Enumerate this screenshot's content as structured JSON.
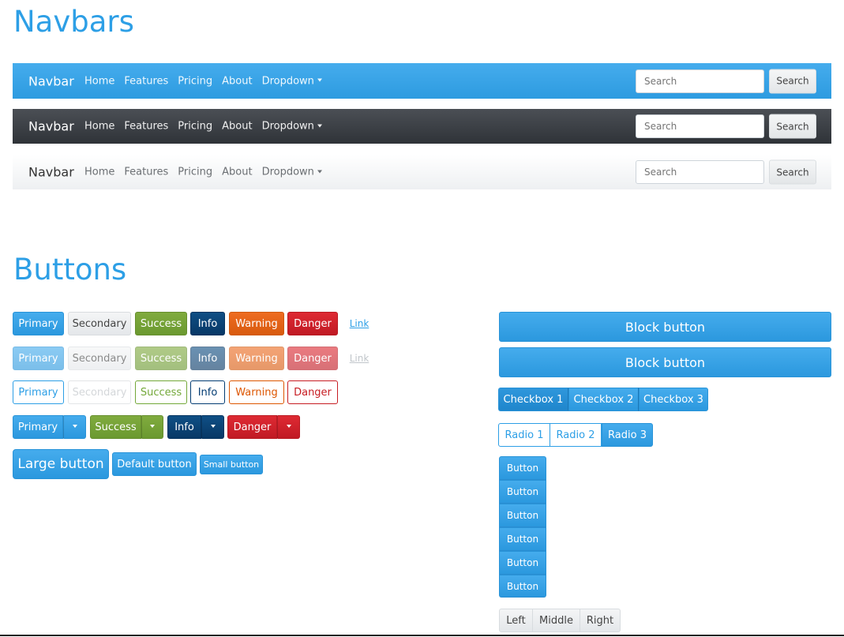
{
  "headings": {
    "navbars": "Navbars",
    "buttons": "Buttons"
  },
  "navbar": {
    "brand": "Navbar",
    "links": [
      "Home",
      "Features",
      "Pricing",
      "About",
      "Dropdown"
    ],
    "search_placeholder": "Search",
    "search_button": "Search"
  },
  "buttons": {
    "row1": [
      "Primary",
      "Secondary",
      "Success",
      "Info",
      "Warning",
      "Danger",
      "Link"
    ],
    "split": [
      "Primary",
      "Success",
      "Info",
      "Danger"
    ],
    "sizes": [
      "Large button",
      "Default button",
      "Small button"
    ],
    "block": [
      "Block button",
      "Block button"
    ],
    "checkboxes": [
      "Checkbox 1",
      "Checkbox 2",
      "Checkbox 3"
    ],
    "radios": [
      "Radio 1",
      "Radio 2",
      "Radio 3"
    ],
    "vertical": [
      "Button",
      "Button",
      "Button",
      "Button",
      "Button",
      "Button"
    ],
    "lmr": [
      "Left",
      "Middle",
      "Right"
    ]
  },
  "colors": {
    "primary": "#2d9fe6",
    "success": "#73a839",
    "info": "#033c73",
    "warning": "#dd5600",
    "danger": "#c71c22",
    "dark": "#343a40"
  }
}
